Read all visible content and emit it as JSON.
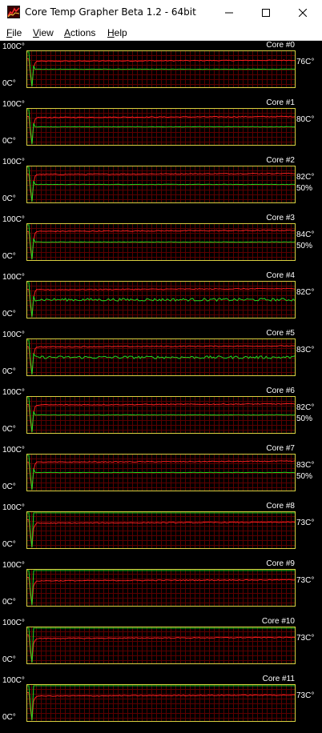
{
  "window": {
    "title": "Core Temp Grapher Beta 1.2 - 64bit"
  },
  "menu": {
    "file": {
      "acc": "F",
      "rest": "ile"
    },
    "view": {
      "acc": "V",
      "rest": "iew"
    },
    "actions": {
      "acc": "A",
      "rest": "ctions"
    },
    "help": {
      "acc": "H",
      "rest": "elp"
    }
  },
  "axis": {
    "top_label": "100C°",
    "bottom_label": "0C°",
    "max": 100,
    "min": 0
  },
  "colors": {
    "temperature_line": "#ff2020",
    "load_line": "#20e020",
    "plot_border": "#d8d040",
    "grid": "#5a0000",
    "background": "#000000"
  },
  "cores": [
    {
      "name": "Core #0",
      "temp": "76C°",
      "load": "",
      "temp_value": 76,
      "load_value": 50,
      "show_load": true
    },
    {
      "name": "Core #1",
      "temp": "80C°",
      "load": "",
      "temp_value": 80,
      "load_value": 50,
      "show_load": true
    },
    {
      "name": "Core #2",
      "temp": "82C°",
      "load": "50%",
      "temp_value": 82,
      "load_value": 50,
      "show_load": true
    },
    {
      "name": "Core #3",
      "temp": "84C°",
      "load": "50%",
      "temp_value": 84,
      "load_value": 50,
      "show_load": true
    },
    {
      "name": "Core #4",
      "temp": "82C°",
      "load": "",
      "temp_value": 82,
      "load_value": 50,
      "show_load": true
    },
    {
      "name": "Core #5",
      "temp": "83C°",
      "load": "",
      "temp_value": 83,
      "load_value": 50,
      "show_load": true
    },
    {
      "name": "Core #6",
      "temp": "82C°",
      "load": "50%",
      "temp_value": 82,
      "load_value": 50,
      "show_load": true
    },
    {
      "name": "Core #7",
      "temp": "83C°",
      "load": "50%",
      "temp_value": 83,
      "load_value": 50,
      "show_load": true
    },
    {
      "name": "Core #8",
      "temp": "73C°",
      "load": "",
      "temp_value": 73,
      "load_value": 100,
      "show_load": true
    },
    {
      "name": "Core #9",
      "temp": "73C°",
      "load": "",
      "temp_value": 73,
      "load_value": 100,
      "show_load": true
    },
    {
      "name": "Core #10",
      "temp": "73C°",
      "load": "",
      "temp_value": 73,
      "load_value": 100,
      "show_load": true
    },
    {
      "name": "Core #11",
      "temp": "73C°",
      "load": "",
      "temp_value": 73,
      "load_value": 100,
      "show_load": true
    }
  ]
}
